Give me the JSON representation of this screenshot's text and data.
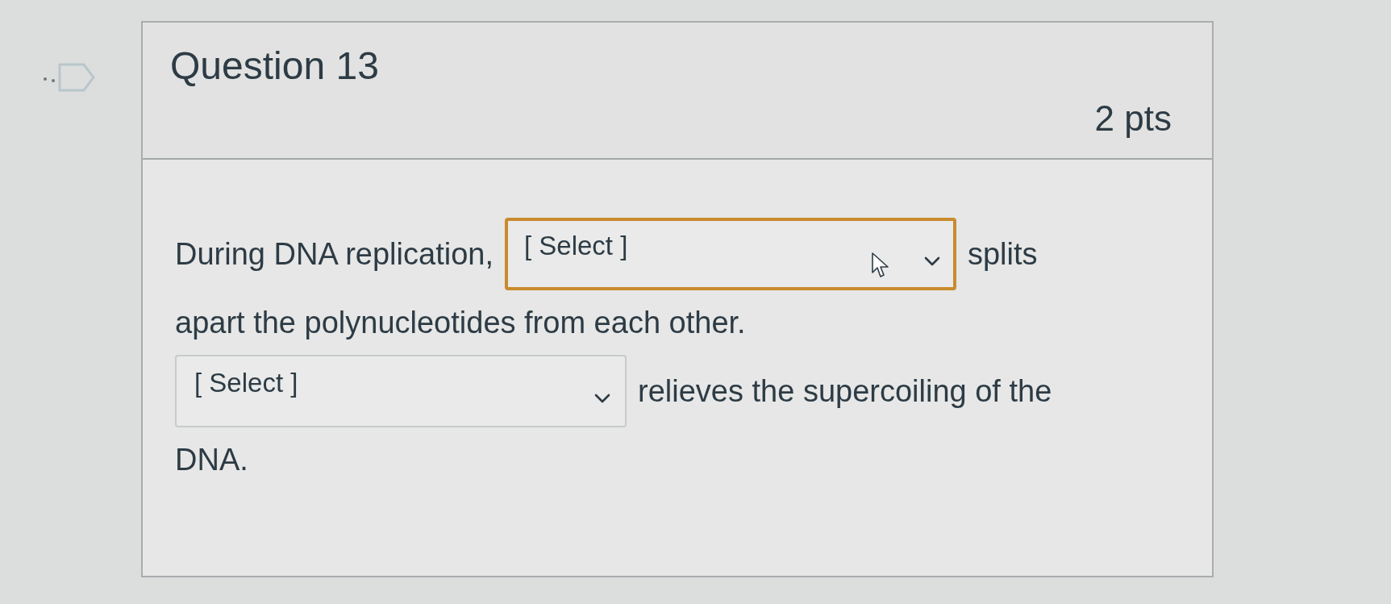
{
  "question": {
    "title": "Question 13",
    "points": "2 pts"
  },
  "paragraphs": [
    {
      "lines": [
        [
          {
            "kind": "text",
            "text": "During DNA replication,"
          },
          {
            "kind": "select",
            "placeholder": "[ Select ]",
            "focused": true,
            "hovered": true
          },
          {
            "kind": "text",
            "text": "splits"
          }
        ],
        [
          {
            "kind": "text",
            "text": "apart the polynucleotides from each other."
          }
        ]
      ]
    },
    {
      "lines": [
        [
          {
            "kind": "select",
            "placeholder": "[ Select ]",
            "focused": false,
            "hovered": false
          },
          {
            "kind": "text",
            "text": "relieves the supercoiling of the"
          }
        ],
        [
          {
            "kind": "text",
            "text": "DNA."
          }
        ]
      ]
    }
  ]
}
